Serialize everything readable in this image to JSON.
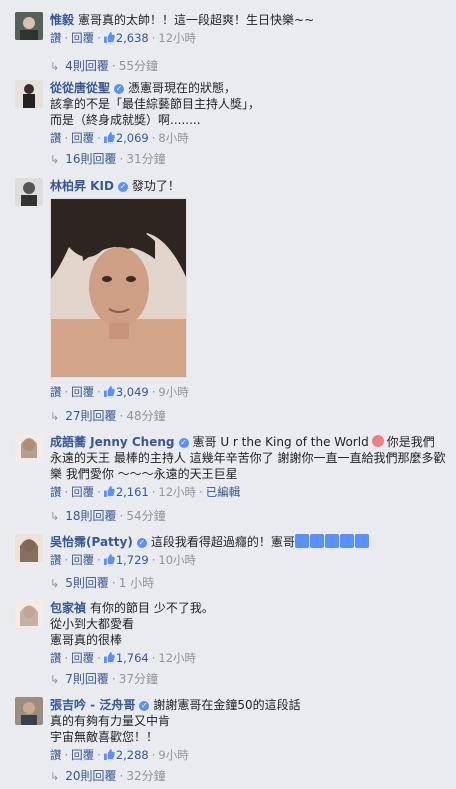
{
  "ui": {
    "like": "讚",
    "reply": "回覆",
    "dot": "·",
    "edited": "已編輯"
  },
  "comments": [
    {
      "name": "惟毅",
      "text": "憲哥真的太帥！！這一段超爽！生日快樂~~",
      "likes": "2,638",
      "time": "12小時",
      "replies_label": "4則回覆",
      "replies_time": "55分鐘"
    },
    {
      "name": "從從唐從聖",
      "text_lines": [
        "憑憲哥現在的狀態，",
        "該拿的不是「最佳綜藝節目主持人獎」，",
        "而是（終身成就獎）啊........"
      ],
      "likes": "2,069",
      "time": "8小時",
      "replies_label": "16則回覆",
      "replies_time": "31分鐘"
    },
    {
      "name": "林柏昇 KID",
      "text": "發功了！",
      "likes": "3,049",
      "time": "9小時",
      "replies_label": "27則回覆",
      "replies_time": "48分鐘"
    },
    {
      "name": "成語蕎 Jenny Cheng",
      "text_a": "憲哥 U r the King of the World",
      "text_b": "你是我們永遠的天王 最棒的主持人 這幾年辛苦你了 謝謝你一直一直給我們那麼多歡樂 我們愛你 ～～～永遠的天王巨星",
      "likes": "2,161",
      "time": "12小時",
      "replies_label": "18則回覆",
      "replies_time": "54分鐘"
    },
    {
      "name": "吳怡霈(Patty)",
      "text": "這段我看得超過癮的！憲哥",
      "likes": "1,729",
      "time": "10小時",
      "replies_label": "5則回覆",
      "replies_time": "1 小時"
    },
    {
      "name": "包家禎",
      "text_lines": [
        "有你的節目 少不了我。",
        "從小到大都愛看",
        "憲哥真的很棒"
      ],
      "likes": "1,764",
      "time": "12小時",
      "replies_label": "7則回覆",
      "replies_time": "37分鐘"
    },
    {
      "name": "張吉吟 - 泛舟哥",
      "text_lines": [
        "謝謝憲哥在金鐘50的這段話",
        "真的有夠有力量又中肯",
        "宇宙無敵喜歡您！！"
      ],
      "likes": "2,288",
      "time": "9小時",
      "replies_label": "20則回覆",
      "replies_time": "32分鐘"
    }
  ],
  "colors": {
    "link": "#365899",
    "meta": "#90949c",
    "background": "#e9ebee",
    "badge": "#5890ff"
  }
}
